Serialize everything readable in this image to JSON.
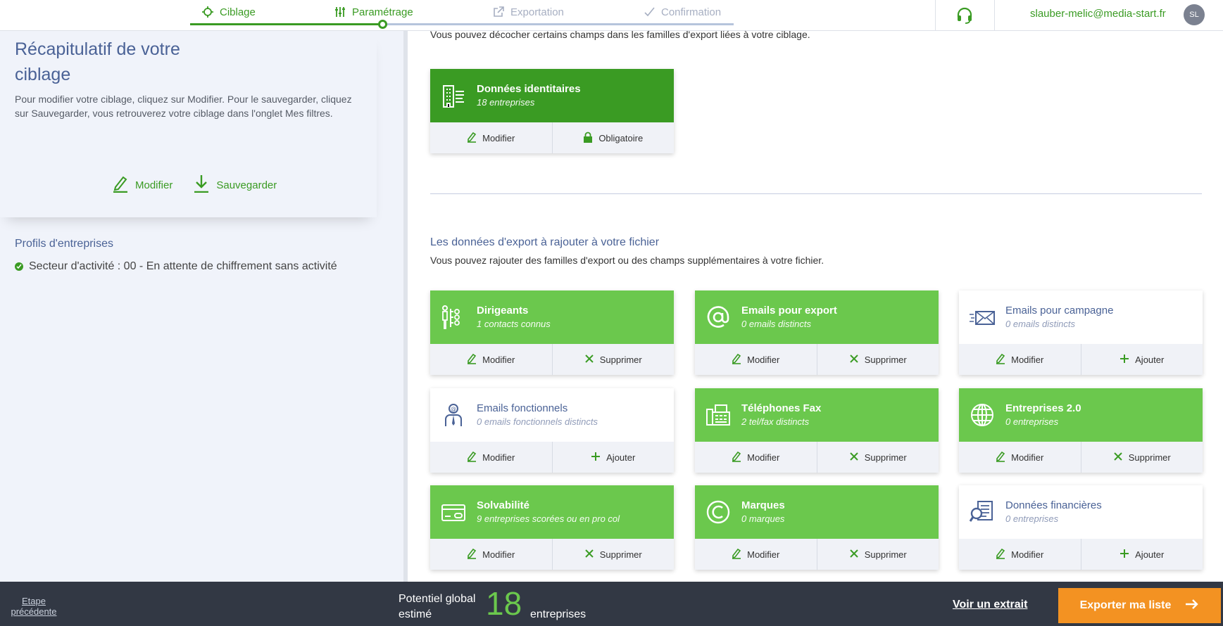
{
  "steps": [
    {
      "label": "Ciblage",
      "icon": "target-icon"
    },
    {
      "label": "Paramétrage",
      "icon": "sliders-icon"
    },
    {
      "label": "Exportation",
      "icon": "external-link-icon"
    },
    {
      "label": "Confirmation",
      "icon": "check-icon"
    }
  ],
  "header": {
    "user_email": "slauber-melic@media-start.fr",
    "avatar_initials": "SL"
  },
  "sidebar": {
    "title": "Récapitulatif de votre ciblage",
    "description": "Pour modifier votre ciblage, cliquez sur Modifier. Pour le sauvegarder, cliquez sur Sauvegarder, vous retrouverez votre ciblage dans l'onglet Mes filtres.",
    "modify_label": "Modifier",
    "save_label": "Sauvegarder",
    "profiles_title": "Profils d'entreprises",
    "criteria": [
      "Secteur d'activité : 00 - En attente de chiffrement sans activité"
    ]
  },
  "main": {
    "intro_text": "Vous pouvez décocher certains champs dans les familles d'export liées à votre ciblage.",
    "section_title": "Les données d'export à rajouter à votre fichier",
    "section_desc": "Vous pouvez rajouter des familles d'export ou des champs supplémentaires à votre fichier.",
    "required_card": {
      "title": "Données identitaires",
      "subtitle": "18 entreprises",
      "btn1": "Modifier",
      "btn2": "Obligatoire"
    },
    "cards": [
      {
        "title": "Dirigeants",
        "subtitle": "1 contacts connus",
        "btn1": "Modifier",
        "btn2": "Supprimer",
        "icon": "executives-icon"
      },
      {
        "title": "Emails pour export",
        "subtitle": "0 emails distincts",
        "btn1": "Modifier",
        "btn2": "Supprimer",
        "icon": "at-sign-icon"
      },
      {
        "title": "Emails pour campagne",
        "subtitle": "0 emails distincts",
        "btn1": "Modifier",
        "btn2": "Ajouter",
        "icon": "envelope-icon"
      },
      {
        "title": "Emails fonctionnels",
        "subtitle": "0 emails fonctionnels distincts",
        "btn1": "Modifier",
        "btn2": "Ajouter",
        "icon": "person-at-icon"
      },
      {
        "title": "Téléphones Fax",
        "subtitle": "2 tel/fax distincts",
        "btn1": "Modifier",
        "btn2": "Supprimer",
        "icon": "fax-icon"
      },
      {
        "title": "Entreprises 2.0",
        "subtitle": "0 entreprises",
        "btn1": "Modifier",
        "btn2": "Supprimer",
        "icon": "globe-icon"
      },
      {
        "title": "Solvabilité",
        "subtitle": "9 entreprises scorées ou en pro col",
        "btn1": "Modifier",
        "btn2": "Supprimer",
        "icon": "credit-card-icon"
      },
      {
        "title": "Marques",
        "subtitle": "0 marques",
        "btn1": "Modifier",
        "btn2": "Supprimer",
        "icon": "copyright-icon"
      },
      {
        "title": "Données financières",
        "subtitle": "0 entreprises",
        "btn1": "Modifier",
        "btn2": "Ajouter",
        "icon": "financial-doc-icon"
      }
    ]
  },
  "footer": {
    "prev_label": "Etape précédente",
    "potential_label": "Potentiel global estimé",
    "potential_value": "18",
    "potential_unit": "entreprises",
    "extract_label": "Voir un extrait",
    "export_label": "Exporter ma liste"
  },
  "colors": {
    "green_dark": "#3a9b23",
    "green_light": "#6bc84d",
    "blue_text": "#4a6296",
    "orange": "#f39222",
    "footer_bg": "#323844"
  }
}
